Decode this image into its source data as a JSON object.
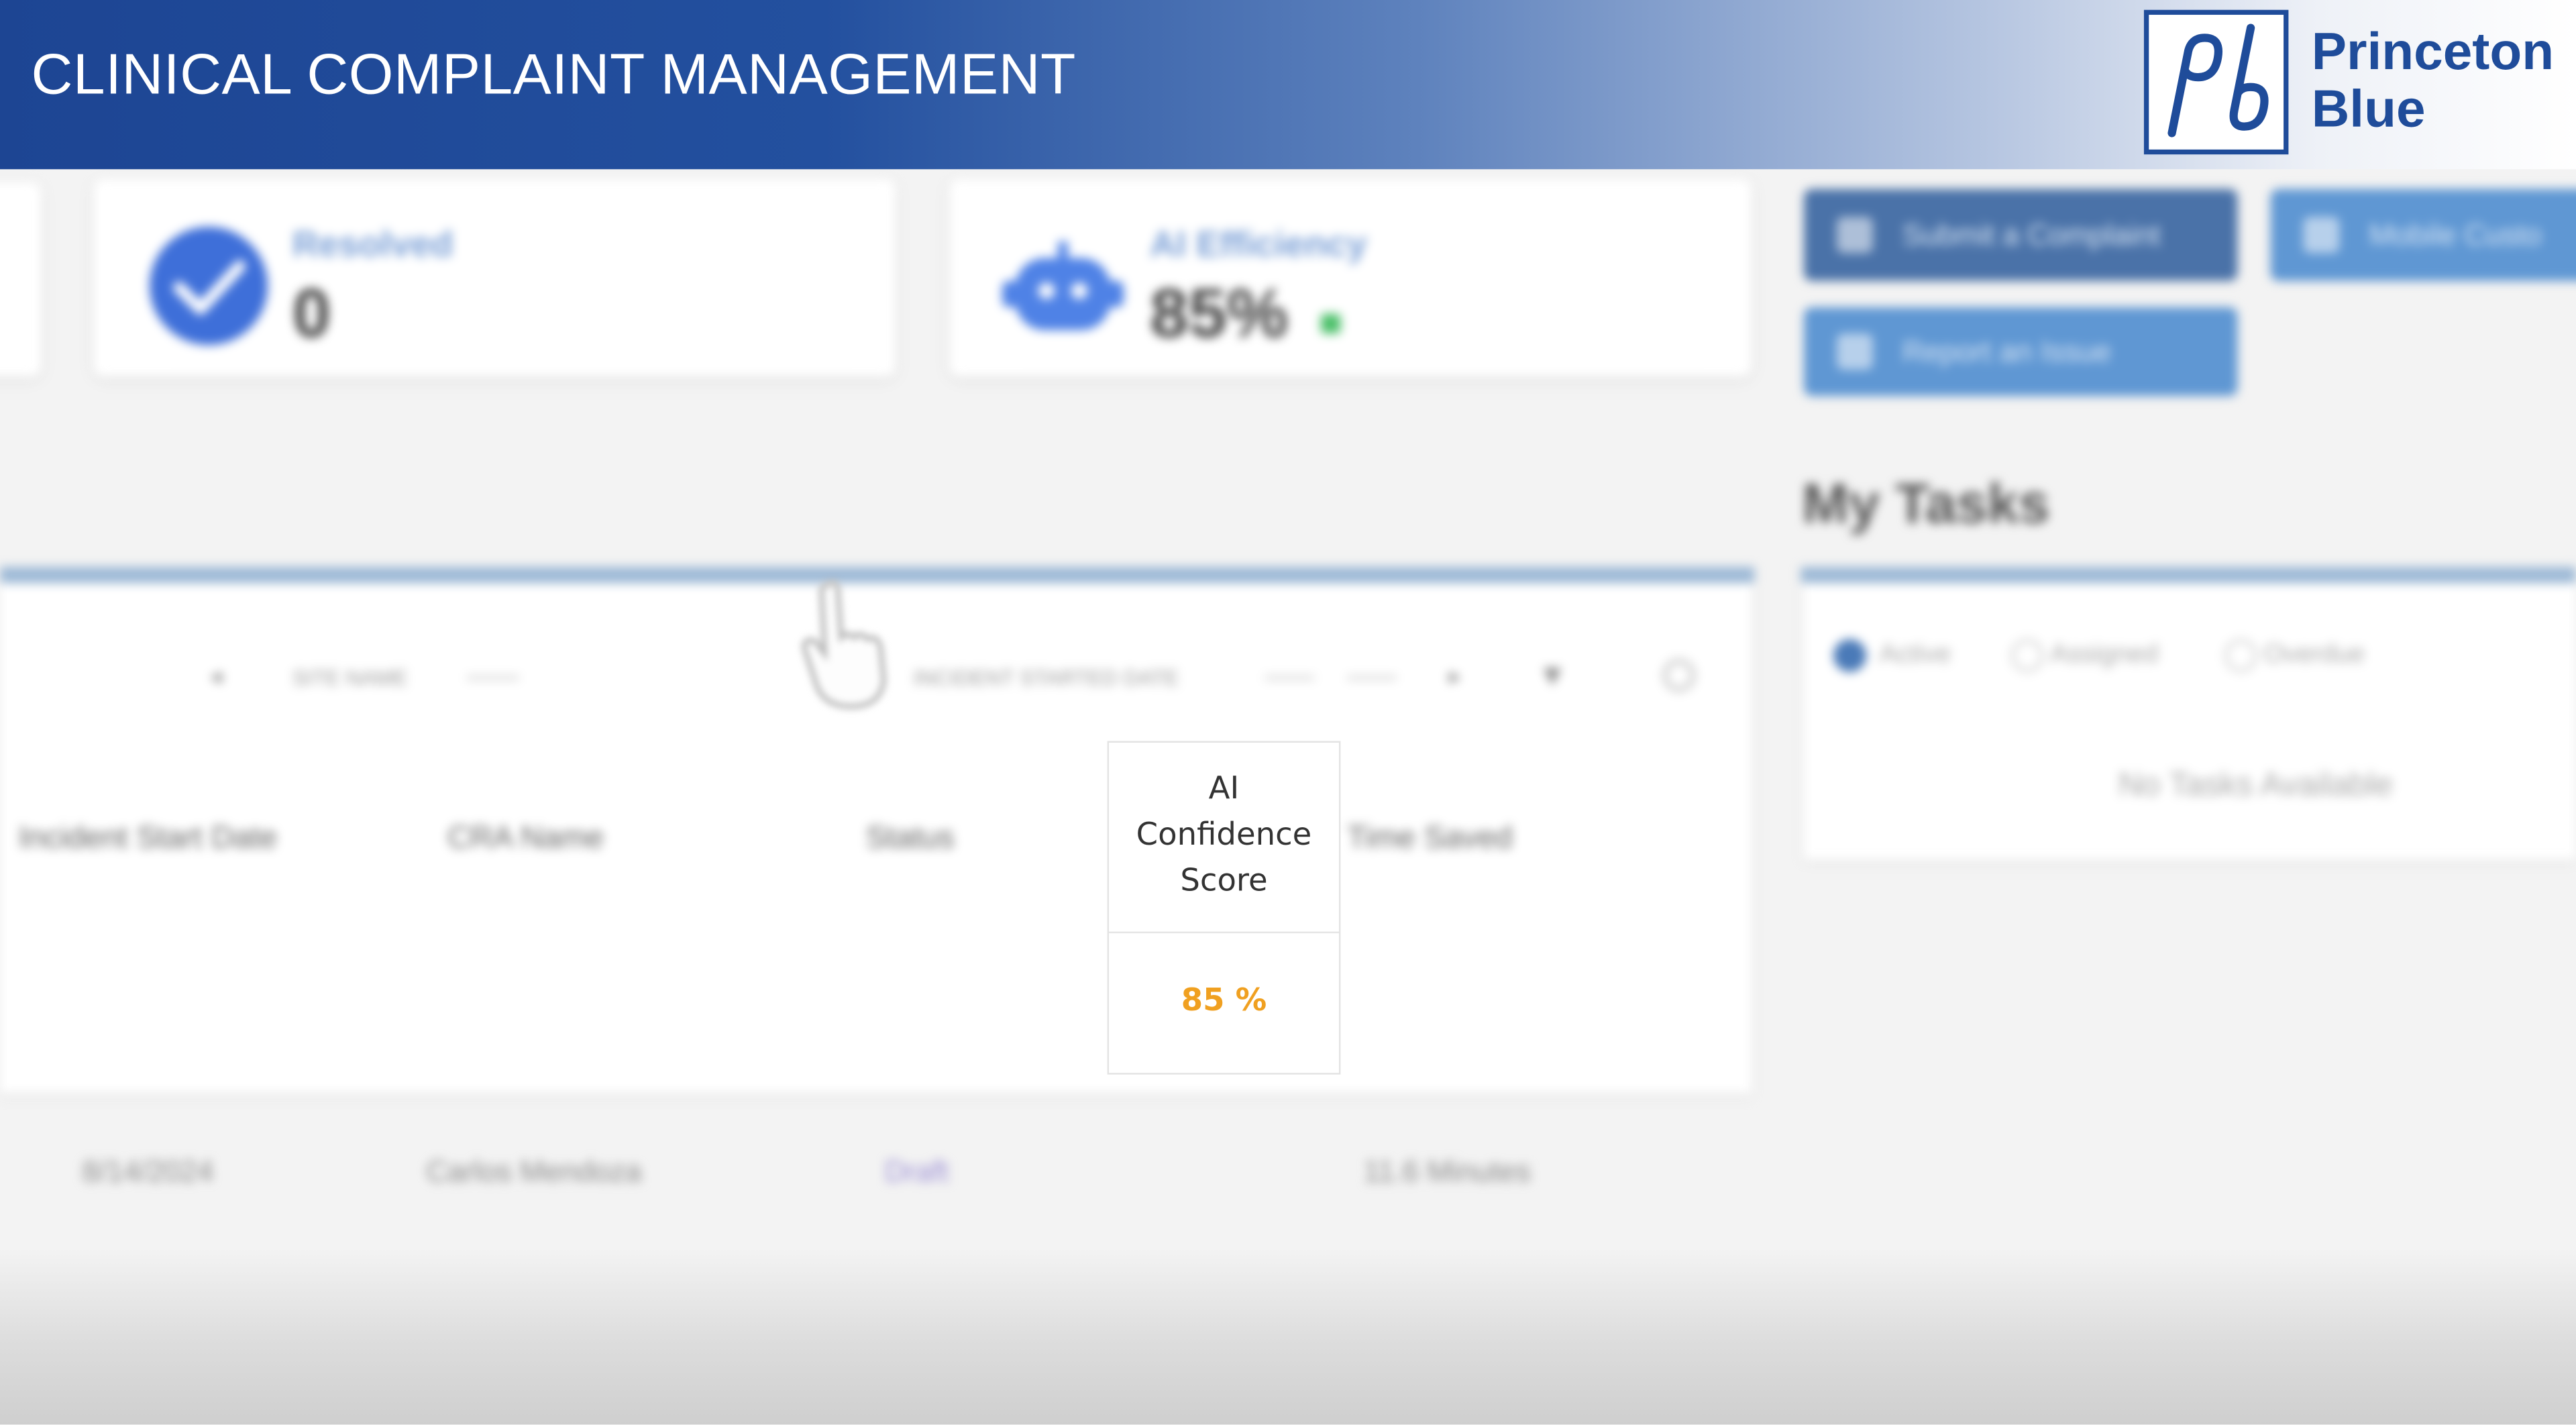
{
  "banner": {
    "title": "CLINICAL COMPLAINT MANAGEMENT",
    "logo_line1": "Princeton",
    "logo_line2": "Blue",
    "logo_mark": "pb"
  },
  "stats": {
    "resolved_label": "Resolved",
    "resolved_value": "0",
    "efficiency_label": "AI Efficiency",
    "efficiency_value": "85%",
    "efficiency_trend_icon": "up-arrow-icon"
  },
  "actions": {
    "submit_label": "Submit a Complaint",
    "mobile_label": "Mobile Custo",
    "report_label": "Report an Issue"
  },
  "tasks": {
    "title": "My Tasks",
    "filters": [
      "Active",
      "Assigned",
      "Overdue"
    ],
    "selected_filter": "Active",
    "empty_text": "No Tasks Available"
  },
  "table": {
    "toolbar": {
      "site_label": "SITE NAME",
      "incident_label": "INCIDENT STARTED DATE"
    },
    "columns": [
      "Incident Start Date",
      "CRA Name",
      "Status",
      "AI Confidence Score",
      "Time Saved"
    ],
    "ai_header_lines": [
      "AI",
      "Confidence",
      "Score"
    ],
    "rows": [
      {
        "incident_start_date": "8/14/2024",
        "cra_name": "Carlos Mendoza",
        "status": "Draft",
        "ai_confidence_score": "85 %",
        "time_saved": "11.6 Minutes"
      }
    ]
  },
  "colors": {
    "banner_start": "#1d4593",
    "accent_blue": "#4a7ab8",
    "score_orange": "#f0a020",
    "status_purple": "#9b8fd4"
  }
}
